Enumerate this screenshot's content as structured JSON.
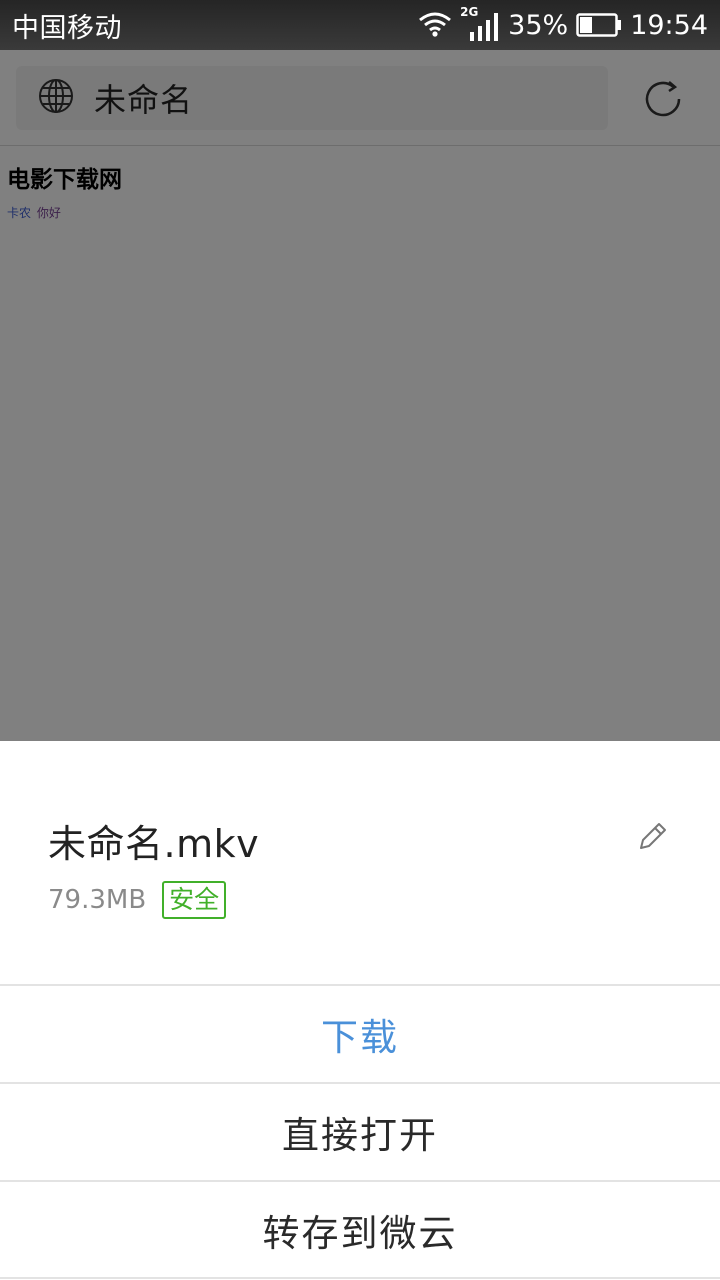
{
  "status_bar": {
    "carrier": "中国移动",
    "network_type": "2G",
    "battery_percent": "35%",
    "time": "19:54",
    "icons": [
      "wifi-icon",
      "signal-icon",
      "battery-icon"
    ]
  },
  "browser": {
    "page_title": "未命名",
    "icons": [
      "globe-icon",
      "refresh-icon"
    ]
  },
  "page": {
    "heading": "电影下载网",
    "links": [
      "卡农",
      "你好"
    ]
  },
  "download_sheet": {
    "file_name": "未命名.mkv",
    "file_size": "79.3MB",
    "safety_badge": "安全",
    "actions": {
      "download": "下载",
      "open_directly": "直接打开",
      "save_to_weiyun": "转存到微云"
    },
    "colors": {
      "accent": "#4a90d9",
      "safe_green": "#41b02a"
    }
  }
}
